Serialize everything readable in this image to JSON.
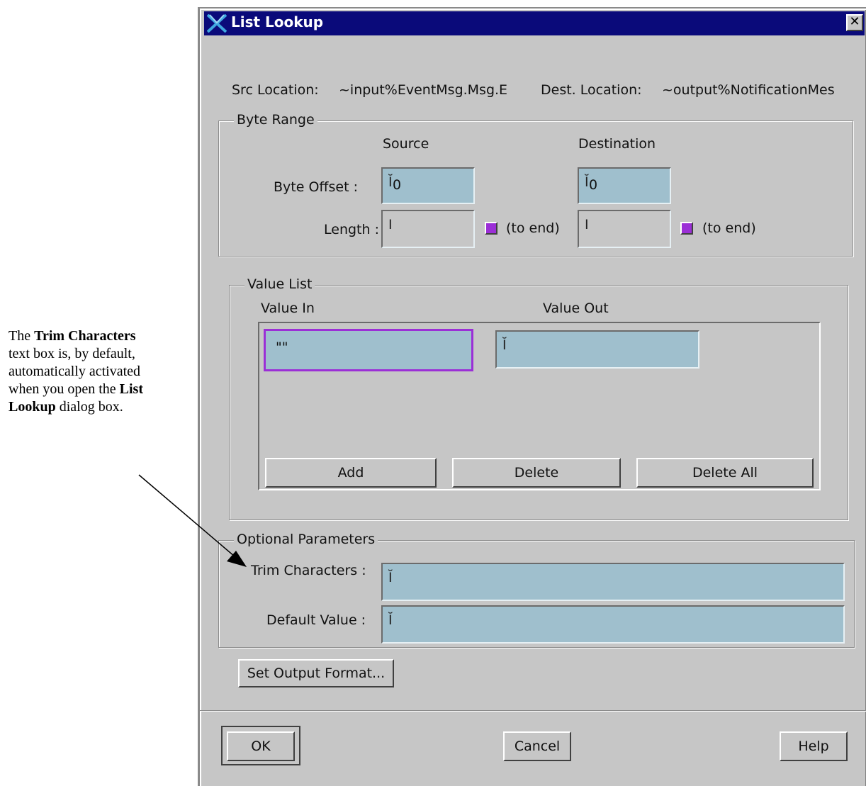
{
  "annotation": {
    "parts": [
      {
        "text": "The ",
        "bold": false
      },
      {
        "text": "Trim Characters",
        "bold": true
      },
      {
        "text": " text box is, by default, automatically activated when you open the ",
        "bold": false
      },
      {
        "text": "List Lookup",
        "bold": true
      },
      {
        "text": " dialog box.",
        "bold": false
      }
    ]
  },
  "window": {
    "title": "List Lookup",
    "close_label": "✕"
  },
  "locations": {
    "src_label": "Src Location:",
    "src_value": "~input%EventMsg.Msg.E",
    "dest_label": "Dest. Location:",
    "dest_value": "~output%NotificationMes"
  },
  "byte_range": {
    "title": "Byte Range",
    "source_header": "Source",
    "destination_header": "Destination",
    "offset_label": "Byte Offset :",
    "length_label": "Length :",
    "source_offset": "0",
    "dest_offset": "0",
    "source_length": "",
    "dest_length": "",
    "to_end_label_src": "(to end)",
    "to_end_label_dest": "(to end)"
  },
  "value_list": {
    "title": "Value List",
    "col_in": "Value In",
    "col_out": "Value Out",
    "row_in_value": "\"\"",
    "row_out_value": "",
    "add_label": "Add",
    "delete_label": "Delete",
    "delete_all_label": "Delete All"
  },
  "optional": {
    "title": "Optional Parameters",
    "trim_label": "Trim Characters :",
    "default_label": "Default Value :",
    "trim_value": "",
    "default_value": ""
  },
  "buttons": {
    "set_output_format": "Set Output Format...",
    "ok": "OK",
    "cancel": "Cancel",
    "help": "Help"
  },
  "colors": {
    "title_bar": "#0a0a7a",
    "field_bg": "#9fbfcd",
    "checkbox": "#9b2fd6",
    "focus_border": "#9b2fd6"
  }
}
